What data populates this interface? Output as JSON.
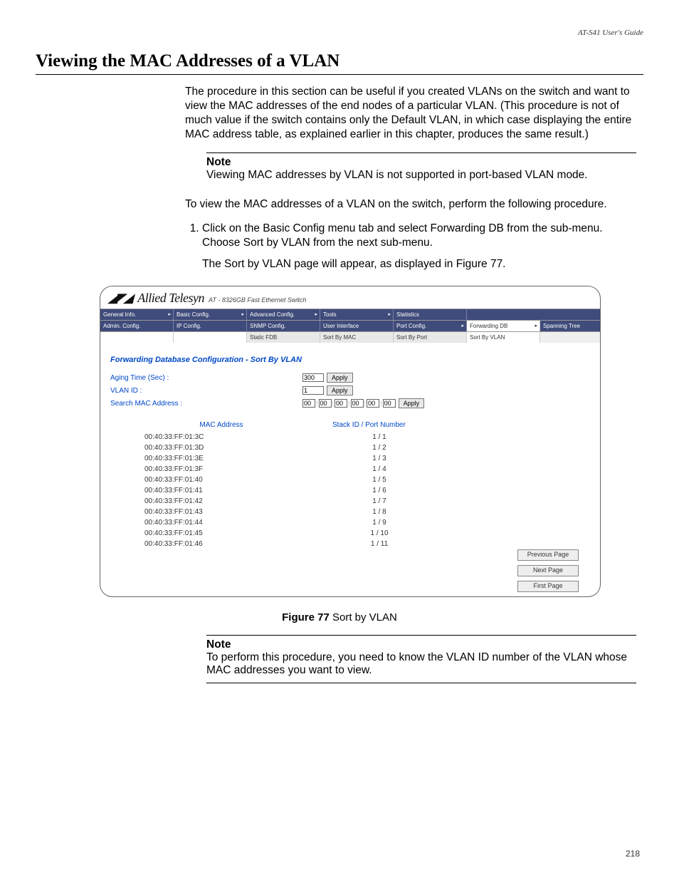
{
  "header": {
    "guide": "AT-S41 User's Guide"
  },
  "section": {
    "title": "Viewing the MAC Addresses of a VLAN"
  },
  "para1": "The procedure in this section can be useful if you created VLANs on the switch and want to view the MAC addresses of the end nodes of a particular VLAN. (This procedure is not of much value if the switch contains only the Default VLAN, in which case displaying the entire MAC address table, as explained earlier in this chapter, produces the same result.)",
  "note1": {
    "label": "Note",
    "text": "Viewing MAC addresses by VLAN is not supported in port-based VLAN mode."
  },
  "para2": "To view the MAC addresses of a VLAN on the switch, perform the following procedure.",
  "step1": "Click on the Basic Config menu tab and select Forwarding DB from the sub-menu. Choose Sort by VLAN from the next sub-menu.",
  "step1b": "The Sort by VLAN page will appear, as displayed in Figure 77.",
  "figure": {
    "brand": "Allied Telesyn",
    "model": "AT - 8326GB Fast Ethernet Switch",
    "menu_r1": [
      "General Info.",
      "Basic Config.",
      "Advanced Config.",
      "Tools",
      "Statistics"
    ],
    "menu_r2": [
      "Admin. Config.",
      "IP Config.",
      "SNMP Config.",
      "User Interface",
      "Port Config.",
      "Forwarding DB",
      "Spanning Tree"
    ],
    "menu_r3": [
      "Static FDB",
      "Sort By MAC",
      "Sort By Port",
      "Sort By VLAN"
    ],
    "panel_title": "Forwarding Database Configuration - Sort By VLAN",
    "aging_label": "Aging Time (Sec) :",
    "aging_value": "300",
    "vlan_label": "VLAN ID :",
    "vlan_value": "1",
    "search_label": "Search MAC Address :",
    "mac_octets": [
      "00",
      "00",
      "00",
      "00",
      "00",
      "00"
    ],
    "apply": "Apply",
    "col1": "MAC Address",
    "col2": "Stack ID / Port Number",
    "rows": [
      {
        "mac": "00:40:33:FF:01:3C",
        "port": "1 / 1"
      },
      {
        "mac": "00:40:33:FF:01:3D",
        "port": "1 / 2"
      },
      {
        "mac": "00:40:33:FF:01:3E",
        "port": "1 / 3"
      },
      {
        "mac": "00:40:33:FF:01:3F",
        "port": "1 / 4"
      },
      {
        "mac": "00:40:33:FF:01:40",
        "port": "1 / 5"
      },
      {
        "mac": "00:40:33:FF:01:41",
        "port": "1 / 6"
      },
      {
        "mac": "00:40:33:FF:01:42",
        "port": "1 / 7"
      },
      {
        "mac": "00:40:33:FF:01:43",
        "port": "1 / 8"
      },
      {
        "mac": "00:40:33:FF:01:44",
        "port": "1 / 9"
      },
      {
        "mac": "00:40:33:FF:01:45",
        "port": "1 / 10"
      },
      {
        "mac": "00:40:33:FF:01:46",
        "port": "1 / 11"
      }
    ],
    "prev": "Previous Page",
    "next": "Next Page",
    "first": "First Page"
  },
  "caption": {
    "label": "Figure 77",
    "text": "  Sort by VLAN"
  },
  "note2": {
    "label": "Note",
    "text": "To perform this procedure, you need to know the VLAN ID number of the VLAN whose MAC addresses you want to view."
  },
  "pagenum": "218"
}
